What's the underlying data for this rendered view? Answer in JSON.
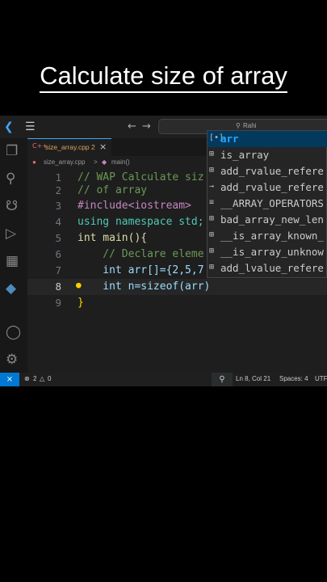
{
  "title": "Calculate size of array",
  "topbar": {
    "search_text": "Rahi"
  },
  "tab": {
    "filename": "size_array.cpp 2",
    "icon": "C++"
  },
  "breadcrumb": {
    "file": "size_array.cpp",
    "separator": ">",
    "symbol": "main()"
  },
  "editor": {
    "lines": [
      {
        "n": "1",
        "text": "// WAP Calculate siz"
      },
      {
        "n": "2",
        "text": "// of array"
      },
      {
        "n": "3",
        "text": "#include<iostream>"
      },
      {
        "n": "4",
        "text": "using namespace std;"
      },
      {
        "n": "5",
        "text": "int main(){"
      },
      {
        "n": "6",
        "text": "    // Declare eleme"
      },
      {
        "n": "7",
        "text": "    int arr[]={2,5,7"
      },
      {
        "n": "8",
        "text": "    int n=sizeof(arr)"
      },
      {
        "n": "9",
        "text": "}"
      }
    ]
  },
  "suggestions": [
    {
      "icon": "[•]",
      "label": "arr"
    },
    {
      "icon": "⊞",
      "label": "is_array"
    },
    {
      "icon": "⊞",
      "label": "add_rvalue_refere"
    },
    {
      "icon": "→",
      "label": "add_rvalue_refere"
    },
    {
      "icon": "≡",
      "label": "__ARRAY_OPERATORS"
    },
    {
      "icon": "⊞",
      "label": "bad_array_new_len"
    },
    {
      "icon": "⊞",
      "label": "__is_array_known_"
    },
    {
      "icon": "⊞",
      "label": "__is_array_unknow"
    },
    {
      "icon": "⊞",
      "label": "add_lvalue_refere"
    }
  ],
  "status": {
    "remote": "⨯",
    "errors": "2",
    "warnings": "0",
    "position": "Ln 8, Col 21",
    "spaces": "Spaces: 4",
    "encoding": "UTF"
  },
  "colors": {
    "accent": "#0078d4",
    "selection": "#04395e",
    "match": "#2aaaff"
  }
}
